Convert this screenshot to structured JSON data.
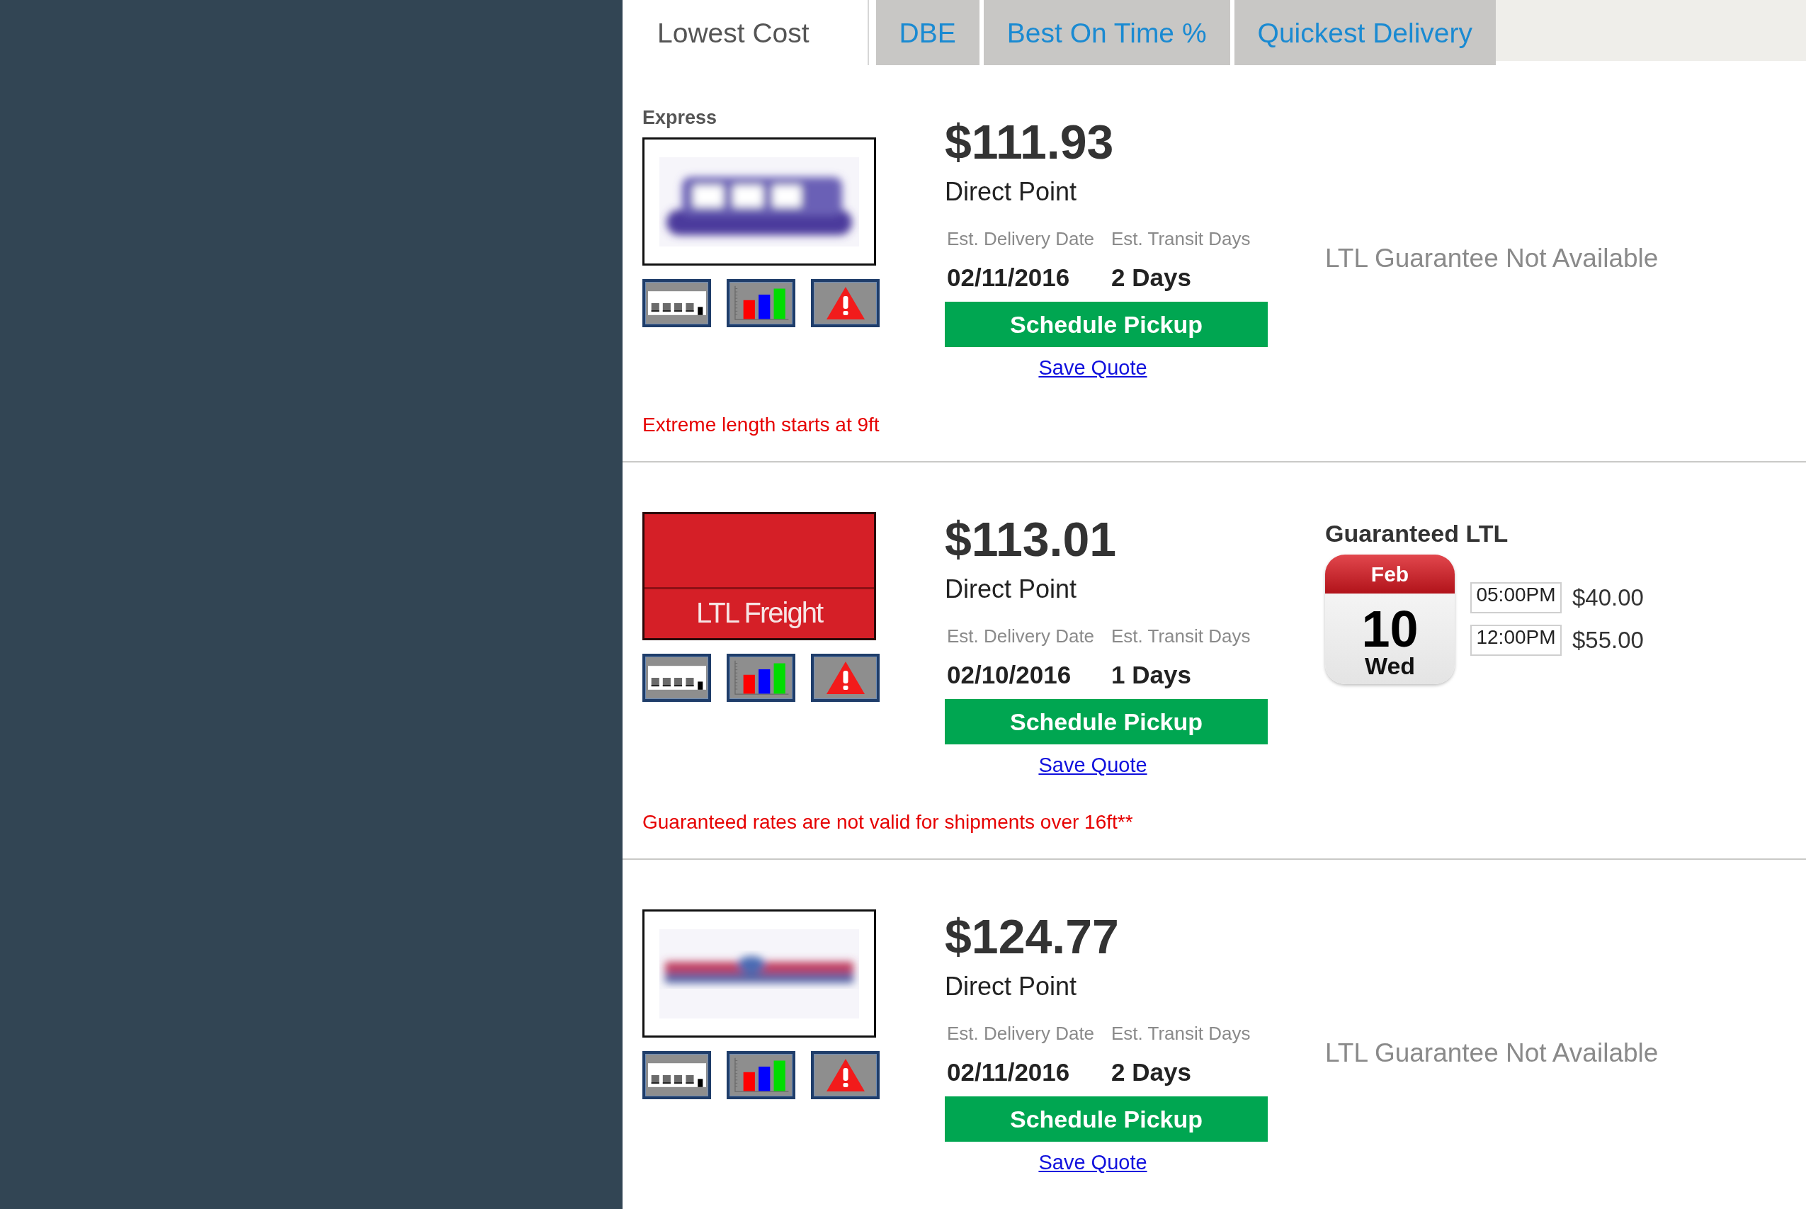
{
  "tabs": [
    {
      "label": "Lowest Cost",
      "selected": true
    },
    {
      "label": "DBE",
      "selected": false
    },
    {
      "label": "Best On Time %",
      "selected": false
    },
    {
      "label": "Quickest Delivery",
      "selected": false
    }
  ],
  "quotes": [
    {
      "service_label": "Express",
      "logo": {
        "kind": "wordmark"
      },
      "price": "$111.93",
      "carrier": "Direct Point",
      "delivery_label": "Est. Delivery Date",
      "transit_label": "Est. Transit Days",
      "delivery_date": "02/11/2016",
      "transit_days": "2 Days",
      "action": "Schedule Pickup",
      "save_link": "Save Quote",
      "guarantee": {
        "kind": "unavailable",
        "text": "LTL Guarantee Not Available"
      },
      "note": "Extreme length starts at 9ft"
    },
    {
      "logo": {
        "kind": "banner",
        "text": "LTL Freight"
      },
      "price": "$113.01",
      "carrier": "Direct Point",
      "delivery_label": "Est. Delivery Date",
      "transit_label": "Est. Transit Days",
      "delivery_date": "02/10/2016",
      "transit_days": "1 Days",
      "action": "Schedule Pickup",
      "save_link": "Save Quote",
      "guarantee": {
        "kind": "guaranteed",
        "title": "Guaranteed LTL",
        "calendar": {
          "month": "Feb",
          "day": "10",
          "weekday": "Wed"
        },
        "options": [
          {
            "time": "05:00PM",
            "price": "$40.00"
          },
          {
            "time": "12:00PM",
            "price": "$55.00"
          }
        ]
      },
      "note": "Guaranteed rates are not valid for shipments over 16ft**"
    },
    {
      "logo": {
        "kind": "stripe"
      },
      "price": "$124.77",
      "carrier": "Direct Point",
      "delivery_label": "Est. Delivery Date",
      "transit_label": "Est. Transit Days",
      "delivery_date": "02/11/2016",
      "transit_days": "2 Days",
      "action": "Schedule Pickup",
      "save_link": "Save Quote",
      "guarantee": {
        "kind": "unavailable",
        "text": "LTL Guarantee Not Available"
      }
    }
  ]
}
